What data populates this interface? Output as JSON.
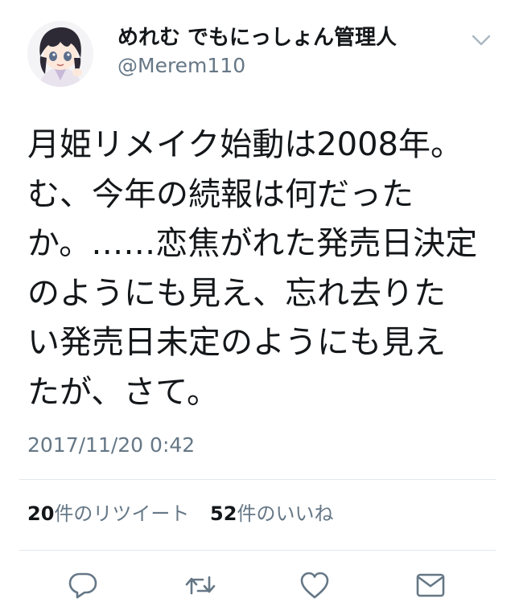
{
  "user": {
    "display_name": "めれむ でもにっしょん管理人",
    "handle": "@Merem110"
  },
  "tweet": {
    "text": "月姫リメイク始動は2008年。\nむ、今年の続報は何だった\nか。……恋焦がれた発売日決定\nのようにも見え、忘れ去りた\nい発売日未定のようにも見え\nたが、さて。",
    "timestamp": "2017/11/20 0:42"
  },
  "stats": {
    "retweet_count": "20",
    "retweet_label": "件のリツイート",
    "like_count": "52",
    "like_label": "件のいいね"
  },
  "actions": {
    "reply": "reply-icon",
    "retweet": "retweet-icon",
    "like": "heart-icon",
    "dm": "envelope-icon"
  },
  "colors": {
    "text": "#14171a",
    "secondary": "#657786",
    "divider": "#e1e8ed",
    "icon": "#657786"
  }
}
